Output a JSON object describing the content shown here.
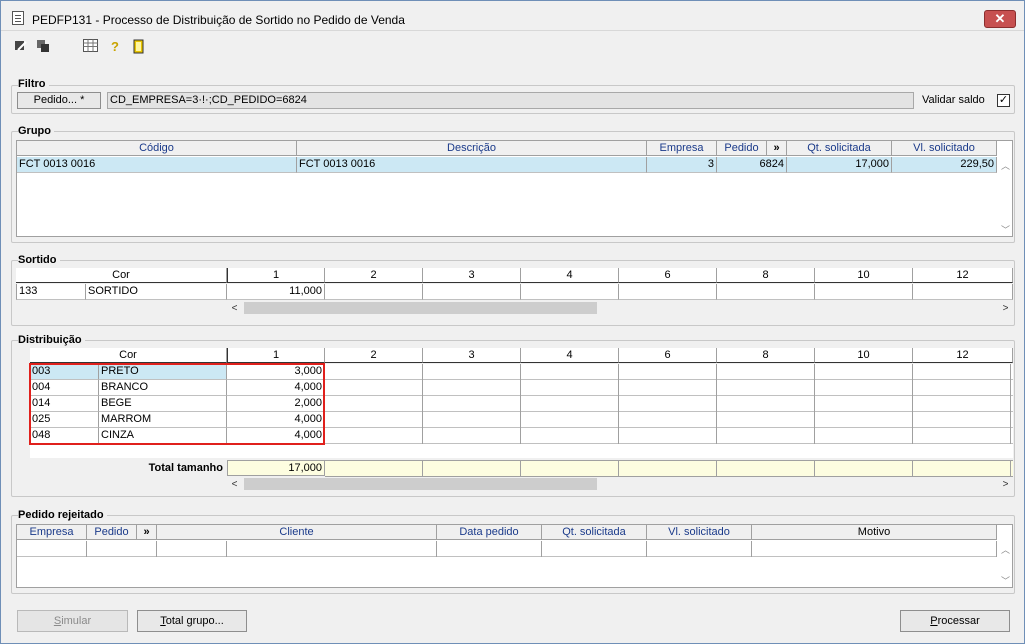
{
  "window": {
    "title": "PEDFP131 - Processo de Distribuição de Sortido no Pedido de Venda",
    "close_label": "✕"
  },
  "toolbar": {
    "icons": [
      "arrow-first-icon",
      "arrow-list-icon",
      "calendar-grid-icon",
      "help-icon",
      "exit-door-icon"
    ]
  },
  "filtro": {
    "title": "Filtro",
    "pedido_button": "Pedido... *",
    "filter_value": "CD_EMPRESA=3·!·;CD_PEDIDO=6824",
    "validar_saldo_label": "Validar saldo",
    "validar_saldo_checked": "✓"
  },
  "grupo": {
    "title": "Grupo",
    "headers": [
      "Código",
      "Descrição",
      "Empresa",
      "Pedido",
      "»",
      "Qt. solicitada",
      "Vl. solicitado"
    ],
    "row": {
      "codigo": "FCT 0013 0016",
      "descricao": "FCT 0013 0016",
      "empresa": "3",
      "pedido": "6824",
      "qt": "17,000",
      "vl": "229,50"
    }
  },
  "sortido": {
    "title": "Sortido",
    "headers": [
      "Cor",
      "1",
      "2",
      "3",
      "4",
      "6",
      "8",
      "10",
      "12"
    ],
    "row": {
      "code": "133",
      "name": "SORTIDO",
      "v1": "11,000"
    }
  },
  "distribuicao": {
    "title": "Distribuição",
    "headers": [
      "Cor",
      "1",
      "2",
      "3",
      "4",
      "6",
      "8",
      "10",
      "12"
    ],
    "rows": [
      {
        "code": "003",
        "name": "PRETO",
        "v1": "3,000"
      },
      {
        "code": "004",
        "name": "BRANCO",
        "v1": "4,000"
      },
      {
        "code": "014",
        "name": "BEGE",
        "v1": "2,000"
      },
      {
        "code": "025",
        "name": "MARROM",
        "v1": "4,000"
      },
      {
        "code": "048",
        "name": "CINZA",
        "v1": "4,000"
      }
    ],
    "total_label": "Total tamanho",
    "total_value": "17,000"
  },
  "rejeitado": {
    "title": "Pedido rejeitado",
    "headers": [
      "Empresa",
      "Pedido",
      "»",
      "Cliente",
      "Data pedido",
      "Qt. solicitada",
      "Vl. solicitado",
      "Motivo"
    ]
  },
  "footer": {
    "simular_prefix": "S",
    "simular_rest": "imular",
    "total_grupo_prefix": "T",
    "total_grupo_rest": "otal grupo...",
    "processar_prefix": "P",
    "processar_rest": "rocessar"
  }
}
